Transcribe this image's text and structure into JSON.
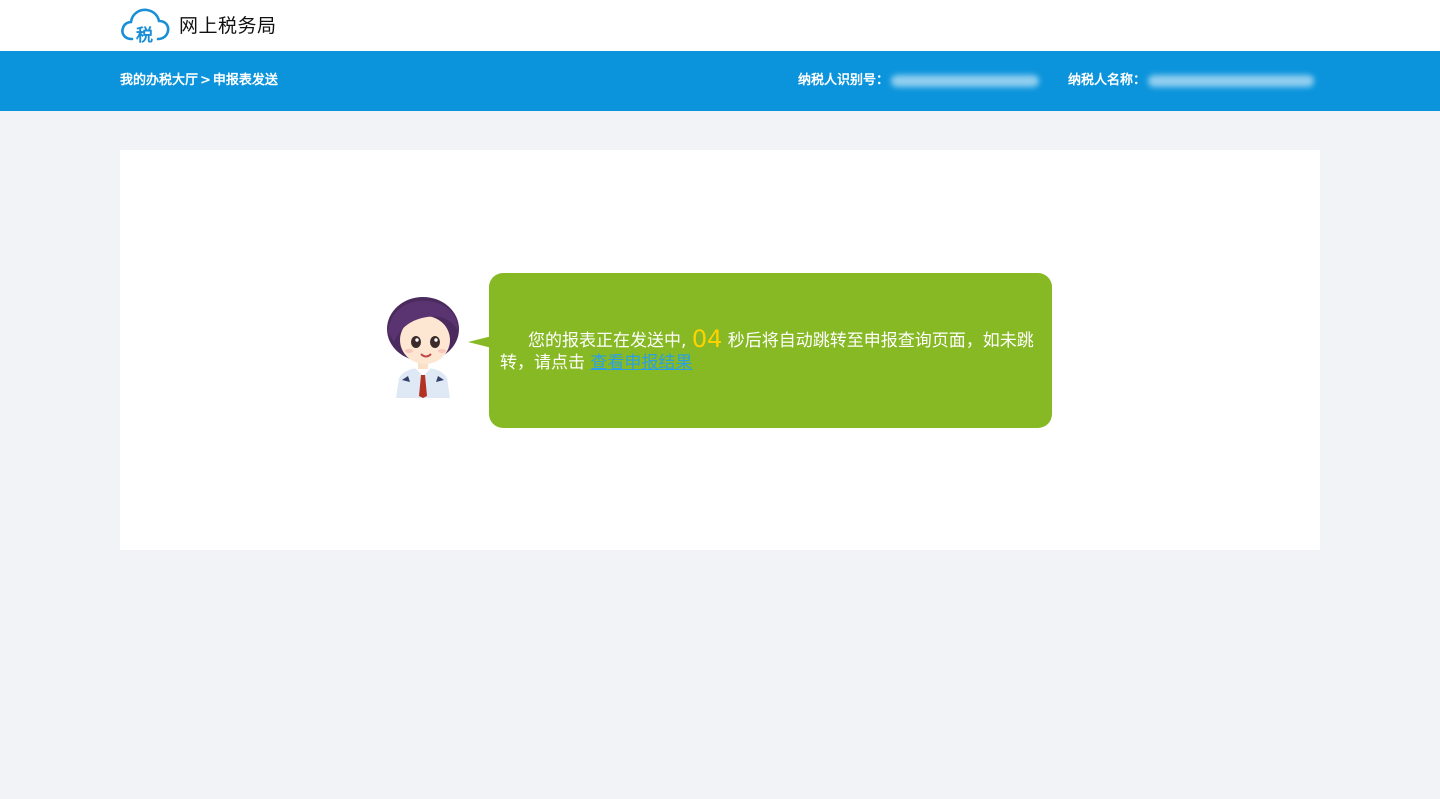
{
  "header": {
    "logo_char": "税",
    "site_title": "网上税务局"
  },
  "nav": {
    "breadcrumb": {
      "home": "我的办税大厅",
      "separator": ">",
      "current": "申报表发送"
    },
    "taxpayer_id_label": "纳税人识别号：",
    "taxpayer_name_label": "纳税人名称："
  },
  "message": {
    "text_before": "您的报表正在发送中, ",
    "countdown": "04",
    "text_after": " 秒后将自动跳转至申报查询页面，如未跳转，请点击 ",
    "link_label": "查看申报结果"
  },
  "colors": {
    "nav_bar": "#0b94dc",
    "bubble": "#86b923",
    "countdown": "#ffd200",
    "link": "#2ba0e6",
    "page_bg": "#f1f3f6"
  }
}
